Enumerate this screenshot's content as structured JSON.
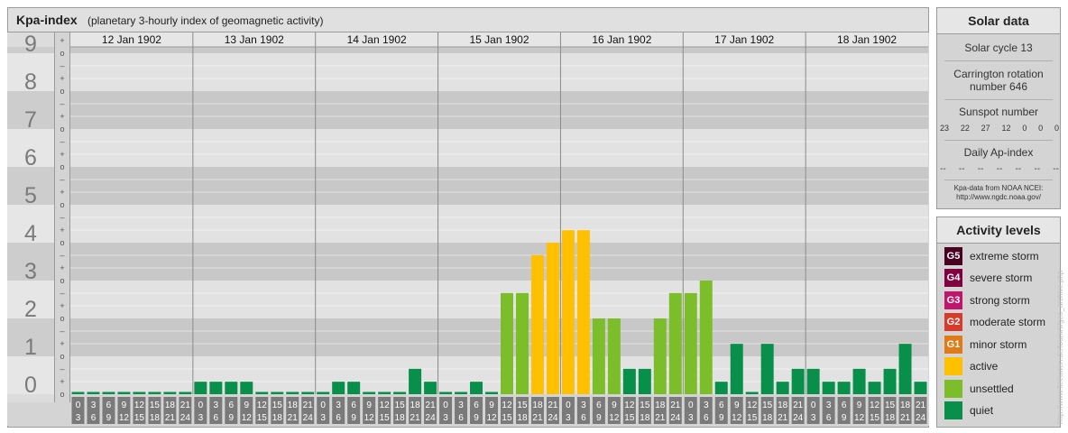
{
  "title": "Kpa-index",
  "subtitle": "(planetary 3-hourly index of geomagnetic activity)",
  "chart_data": {
    "type": "bar",
    "title": "Kpa-index",
    "subtitle": "(planetary 3-hourly index of geomagnetic activity)",
    "ylim": [
      0,
      9.5
    ],
    "y_ticks": [
      "0",
      "1",
      "2",
      "3",
      "4",
      "5",
      "6",
      "7",
      "8",
      "9"
    ],
    "y_minor_ticks": [
      "o",
      "+",
      "–"
    ],
    "days": [
      "12 Jan 1902",
      "13 Jan 1902",
      "14 Jan 1902",
      "15 Jan 1902",
      "16 Jan 1902",
      "17 Jan 1902",
      "18 Jan 1902"
    ],
    "interval_labels": [
      [
        "0",
        "3"
      ],
      [
        "3",
        "6"
      ],
      [
        "6",
        "9"
      ],
      [
        "9",
        "12"
      ],
      [
        "12",
        "15"
      ],
      [
        "15",
        "18"
      ],
      [
        "18",
        "21"
      ],
      [
        "21",
        "24"
      ]
    ],
    "values": [
      [
        0,
        0,
        0,
        0,
        0,
        0,
        0,
        0
      ],
      [
        0.33,
        0.33,
        0.33,
        0.33,
        0,
        0,
        0,
        0
      ],
      [
        0,
        0.33,
        0.33,
        0,
        0,
        0,
        0.67,
        0.33
      ],
      [
        0,
        0,
        0.33,
        0,
        2.67,
        2.67,
        3.67,
        4
      ],
      [
        4.33,
        4.33,
        2,
        2,
        0.67,
        0.67,
        2,
        2.67
      ],
      [
        2.67,
        3,
        0.33,
        1.33,
        0,
        1.33,
        0.33,
        0.67
      ],
      [
        0.67,
        0.33,
        0.33,
        0.67,
        0.33,
        0.67,
        1.33,
        0.33
      ]
    ]
  },
  "levels": [
    {
      "badge": "G5",
      "label": "extreme storm",
      "color": "#4a0020"
    },
    {
      "badge": "G4",
      "label": "severe storm",
      "color": "#800040"
    },
    {
      "badge": "G3",
      "label": "strong storm",
      "color": "#c0156a"
    },
    {
      "badge": "G2",
      "label": "moderate storm",
      "color": "#d83a2c"
    },
    {
      "badge": "G1",
      "label": "minor storm",
      "color": "#e07b18"
    },
    {
      "badge": "",
      "label": "active",
      "color": "#ffc000"
    },
    {
      "badge": "",
      "label": "unsettled",
      "color": "#7cbd2a"
    },
    {
      "badge": "",
      "label": "quiet",
      "color": "#08904a"
    }
  ],
  "solar": {
    "title": "Solar data",
    "cycle": "Solar cycle 13",
    "carrington_1": "Carrington rotation",
    "carrington_2": "number 646",
    "sunspot_title": "Sunspot number",
    "sunspots": [
      "23",
      "22",
      "27",
      "12",
      "0",
      "0",
      "0"
    ],
    "ap_title": "Daily Ap-index",
    "ap": [
      "--",
      "--",
      "--",
      "--",
      "--",
      "--",
      "--"
    ],
    "source_1": "Kpa-data from NOAA NCEI:",
    "source_2": "http://www.ngdc.noaa.gov/"
  },
  "activity_title": "Activity levels",
  "watermark": "http://www.fleeuwen.de/fourani/geo_archive.php"
}
